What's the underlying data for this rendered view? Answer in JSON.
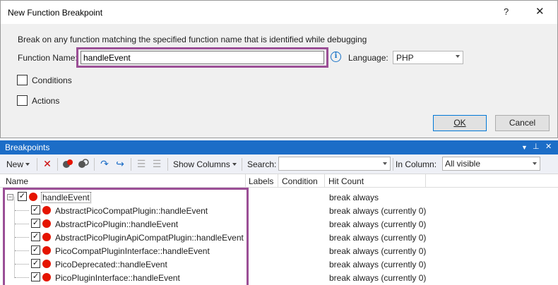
{
  "dialog": {
    "title": "New Function Breakpoint",
    "help_glyph": "?",
    "close_glyph": "✕",
    "description": "Break on any function matching the specified function name that is identified while debugging",
    "function_name_label": "Function Name:",
    "function_name_value": "handleEvent",
    "language_label": "Language:",
    "language_value": "PHP",
    "conditions_label": "Conditions",
    "actions_label": "Actions",
    "ok_label": "OK",
    "cancel_label": "Cancel"
  },
  "panel": {
    "title": "Breakpoints",
    "toolbar": {
      "new_label": "New",
      "show_columns_label": "Show Columns",
      "search_label": "Search:",
      "search_value": "",
      "in_column_label": "In Column:",
      "in_column_value": "All visible"
    },
    "columns": [
      "Name",
      "Labels",
      "Condition",
      "Hit Count"
    ],
    "root": {
      "name": "handleEvent",
      "hit_count": "break always",
      "checked": true
    },
    "children": [
      {
        "name": "AbstractPicoCompatPlugin::handleEvent",
        "hit_count": "break always (currently 0)"
      },
      {
        "name": "AbstractPicoPlugin::handleEvent",
        "hit_count": "break always (currently 0)"
      },
      {
        "name": "AbstractPicoPluginApiCompatPlugin::handleEvent",
        "hit_count": "break always (currently 0)"
      },
      {
        "name": "PicoCompatPluginInterface::handleEvent",
        "hit_count": "break always (currently 0)"
      },
      {
        "name": "PicoDeprecated::handleEvent",
        "hit_count": "break always (currently 0)"
      },
      {
        "name": "PicoPluginInterface::handleEvent",
        "hit_count": "break always (currently 0)"
      }
    ]
  },
  "colors": {
    "highlight": "#9b4f96",
    "panel_title_bg": "#1c6dc7",
    "breakpoint_red": "#e51400"
  }
}
